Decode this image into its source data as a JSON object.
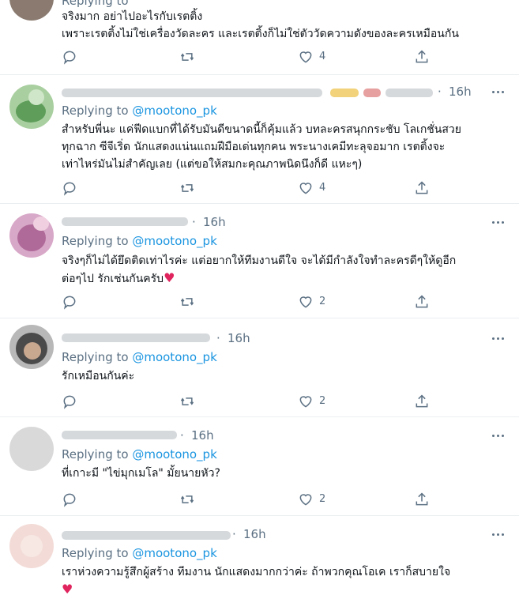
{
  "header_fragment": "Replying to @mootono_pk",
  "tweets": [
    {
      "time": "",
      "replying_prefix": "",
      "handle": "",
      "body": [
        "จริงมาก อย่าไปอะไรกับเรตติ้ง",
        "เพราะเรตติ้งไม่ใช่เครื่องวัดละคร และเรตติ้งก็ไม่ใช่ตัววัดความดังของละครเหมือนกัน"
      ],
      "likes": "4"
    },
    {
      "time": "16h",
      "replying_prefix": "Replying to ",
      "handle": "@mootono_pk",
      "body": [
        "สำหรับพี่นะ แค่ฟีดแบกที่ได้รับมันดีขนาดนี้ก็คุ้มแล้ว บทละครสนุกกระชับ โลเกชั่นสวย",
        "ทุกฉาก ซีจีเริ่ด นักแสดงแน่นแถมฝีมือเด่นทุกคน พระนางเคมีทะลุจอมาก เรตติ้งจะ",
        "เท่าไหร่มันไม่สำคัญเลย (แต่ขอให้สมกะคุณภาพนิดนึงก็ดี แหะๆ)"
      ],
      "likes": "4"
    },
    {
      "time": "16h",
      "replying_prefix": "Replying to ",
      "handle": "@mootono_pk",
      "body": [
        "จริงๆก็ไม่ได้ยึดติดเท่าไรค่ะ แต่อยากให้ทีมงานดีใจ จะได้มีกำลังใจทำละครดีๆให้ดูอีก",
        "ต่อๆไป รักเช่นกันครับ"
      ],
      "heart": "♥",
      "likes": "2"
    },
    {
      "time": "16h",
      "replying_prefix": "Replying to ",
      "handle": "@mootono_pk",
      "body": [
        "รักเหมือนกันค่ะ"
      ],
      "likes": "2"
    },
    {
      "time": "16h",
      "replying_prefix": "Replying to ",
      "handle": "@mootono_pk",
      "body": [
        "ที่เกาะมี \"ไข่มุกเมโล\" มั้ยนายหัว?"
      ],
      "likes": "2"
    },
    {
      "time": "16h",
      "replying_prefix": "Replying to ",
      "handle": "@mootono_pk",
      "body": [
        "เราห่วงความรู้สึกผู้สร้าง ทีมงาน นักแสดงมากกว่าค่ะ ถ้าพวกคุณโอเค เราก็สบายใจ",
        ""
      ],
      "heart": "♥",
      "likes": ""
    }
  ],
  "colors": {
    "accent": "#1b95e0",
    "muted": "#5b7083",
    "heart": "#e0245e"
  },
  "icons": [
    "reply-icon",
    "retweet-icon",
    "like-icon",
    "share-icon",
    "more-icon"
  ]
}
